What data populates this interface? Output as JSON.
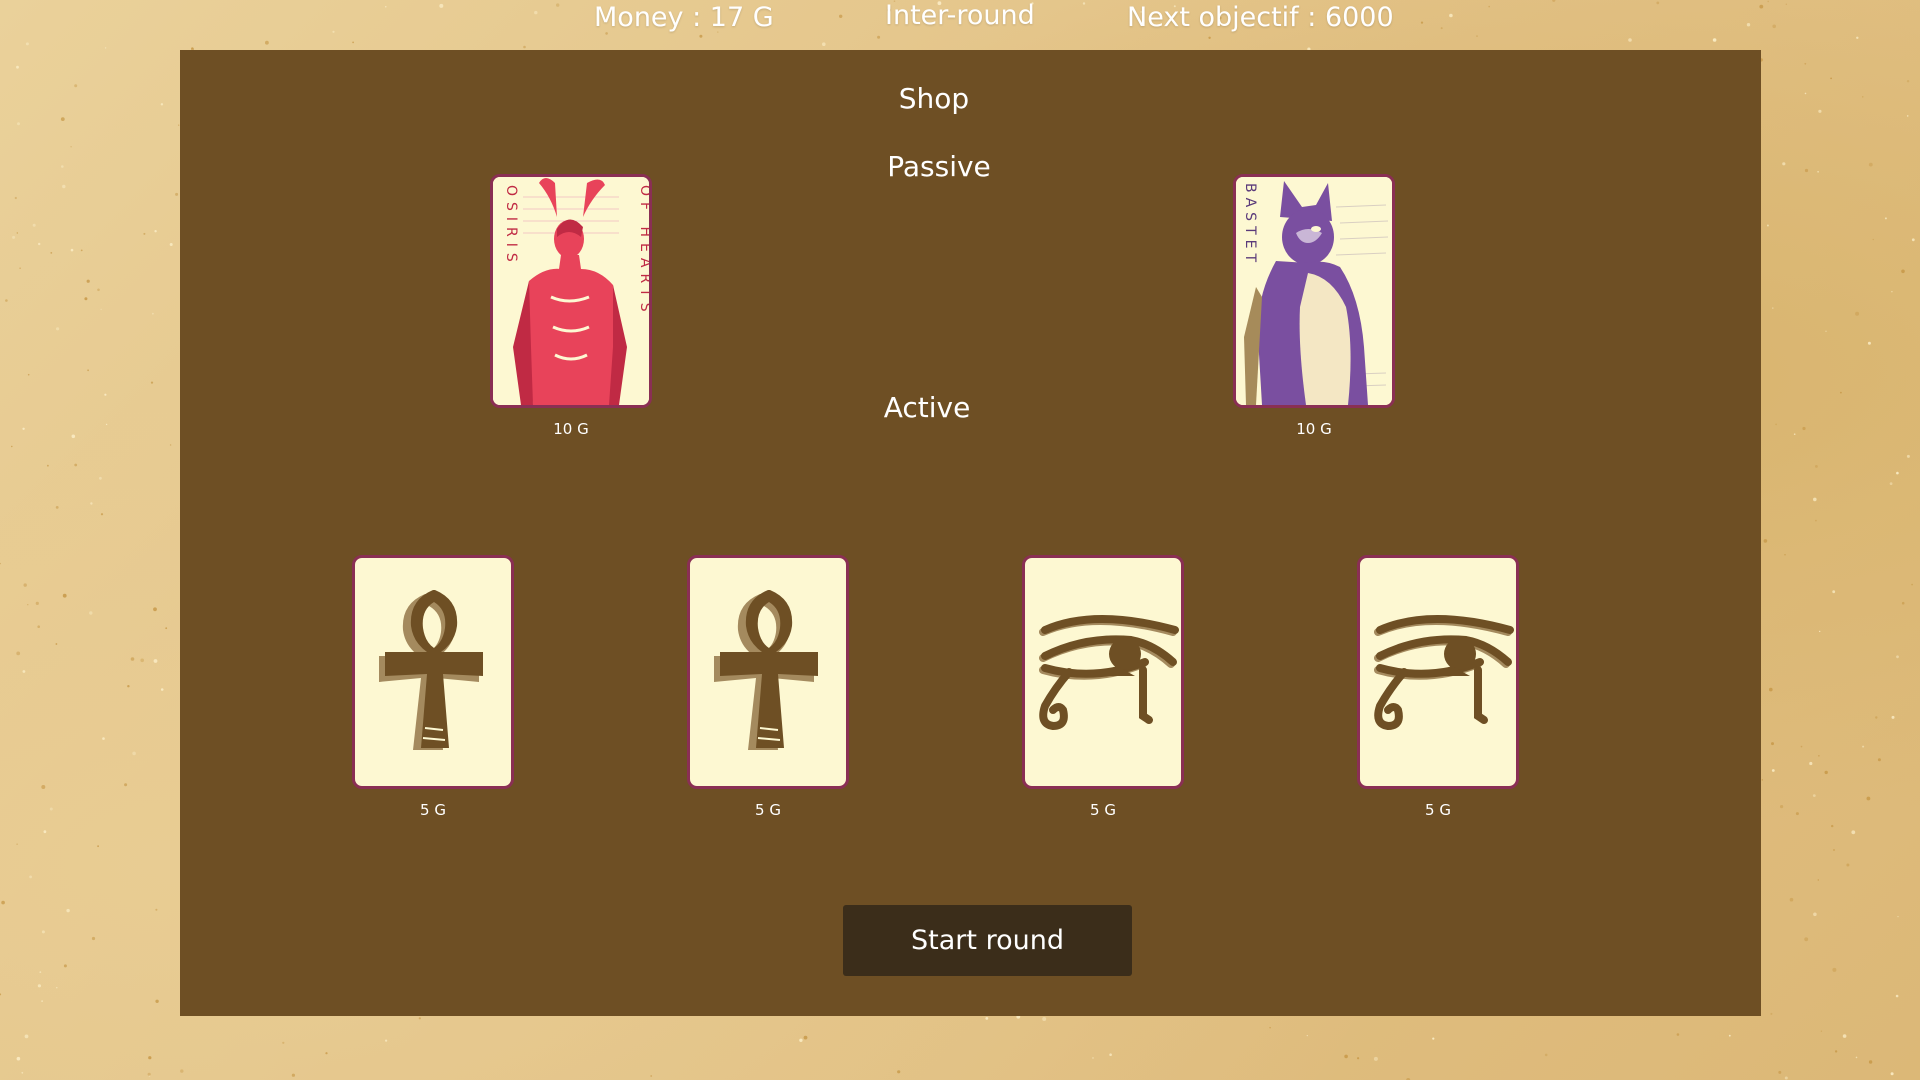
{
  "hud": {
    "money": "Money : 17 G",
    "phase": "Inter-round",
    "objective": "Next objectif : 6000"
  },
  "shop": {
    "title": "Shop",
    "passive_title": "Passive",
    "active_title": "Active",
    "passive_cards": [
      {
        "icon": "osiris-card-art",
        "art_left": "OSIRIS",
        "art_right": "OF HEARTS",
        "price": "10 G"
      },
      {
        "icon": "bastet-card-art",
        "art_left": "BASTET",
        "price": "10 G"
      }
    ],
    "active_cards": [
      {
        "icon": "ankh-icon",
        "price": "5 G"
      },
      {
        "icon": "ankh-icon",
        "price": "5 G"
      },
      {
        "icon": "eye-of-horus-icon",
        "price": "5 G"
      },
      {
        "icon": "eye-of-horus-icon",
        "price": "5 G"
      }
    ]
  },
  "start_button_label": "Start round",
  "colors": {
    "panel": "#6e4f24",
    "card_face": "#fdf8d2",
    "card_border": "#8a2f54",
    "button": "#3b2d1a",
    "osiris_red": "#e8435a",
    "bastet_purple": "#7a4fa0",
    "glyph_brown": "#6e4f24"
  }
}
